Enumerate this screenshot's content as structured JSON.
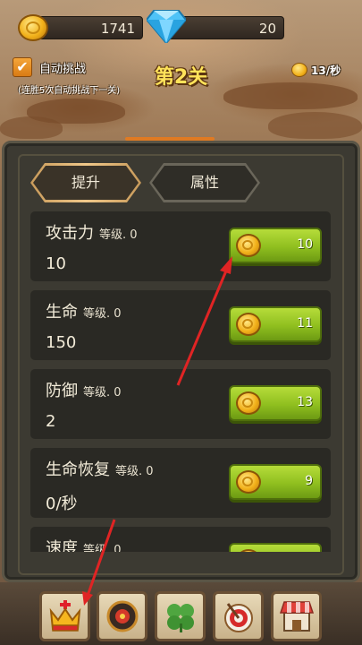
{
  "resources": {
    "gold": "1741",
    "diamonds": "20"
  },
  "auto_battle": {
    "label": "自动挑战",
    "hint": "(连胜5次自动挑战下一关)",
    "checked": true
  },
  "stage": {
    "title": "第2关"
  },
  "income": {
    "rate": "13/秒"
  },
  "tabs": [
    {
      "label": "提升",
      "active": true
    },
    {
      "label": "属性",
      "active": false
    }
  ],
  "stats": [
    {
      "name": "攻击力",
      "level": "等级. 0",
      "value": "10",
      "cost": "10"
    },
    {
      "name": "生命",
      "level": "等级. 0",
      "value": "150",
      "cost": "11"
    },
    {
      "name": "防御",
      "level": "等级. 0",
      "value": "2",
      "cost": "13"
    },
    {
      "name": "生命恢复",
      "level": "等级. 0",
      "value": "0/秒",
      "cost": "9"
    },
    {
      "name": "速度",
      "level": "等级. 0",
      "value": "",
      "cost": ""
    }
  ],
  "nav": [
    {
      "icon": "crown-icon"
    },
    {
      "icon": "medal-icon"
    },
    {
      "icon": "clover-icon"
    },
    {
      "icon": "target-icon"
    },
    {
      "icon": "shop-icon"
    }
  ],
  "colors": {
    "accent_green": "#8fbf1f",
    "title_yellow": "#ffe35a",
    "arrow_red": "#e02424"
  }
}
